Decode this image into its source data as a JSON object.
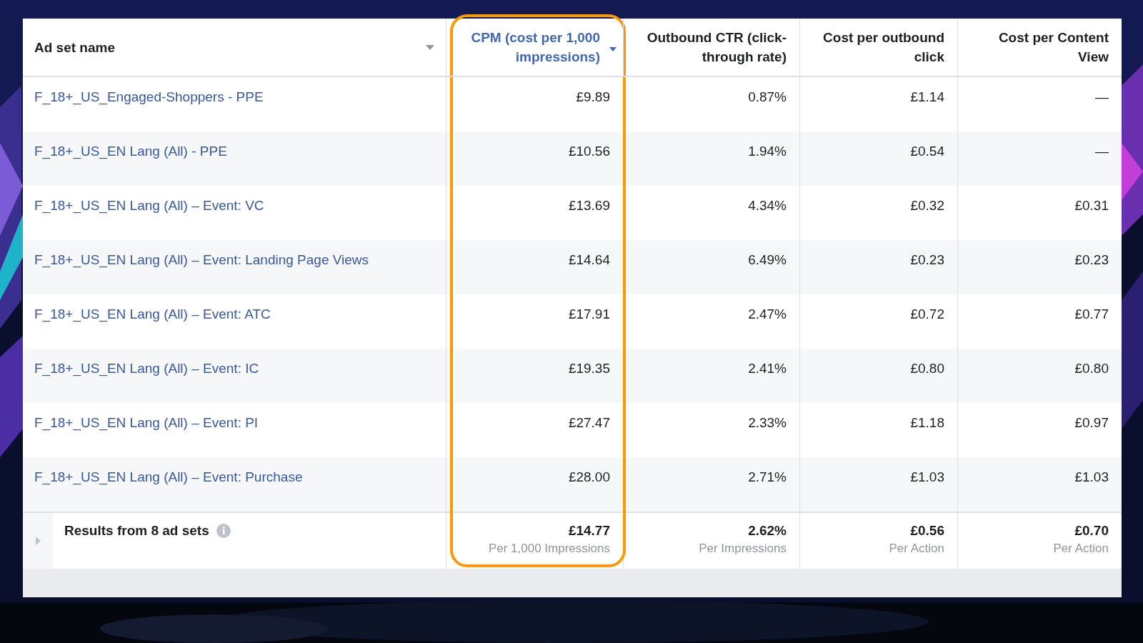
{
  "table": {
    "columns": [
      {
        "label": "Ad set name",
        "sorted": false,
        "dropdown": true,
        "highlighted": false
      },
      {
        "label": "CPM (cost per 1,000 impressions)",
        "sorted": true,
        "dropdown": false,
        "highlighted": true
      },
      {
        "label": "Outbound CTR (click-through rate)",
        "sorted": false,
        "dropdown": false,
        "highlighted": false
      },
      {
        "label": "Cost per outbound click",
        "sorted": false,
        "dropdown": false,
        "highlighted": false
      },
      {
        "label": "Cost per Content View",
        "sorted": false,
        "dropdown": false,
        "highlighted": false
      }
    ],
    "rows": [
      {
        "cells": [
          "F_18+_US_Engaged-Shoppers - PPE",
          "£9.89",
          "0.87%",
          "£1.14",
          "—"
        ]
      },
      {
        "cells": [
          "F_18+_US_EN Lang (All) - PPE",
          "£10.56",
          "1.94%",
          "£0.54",
          "—"
        ]
      },
      {
        "cells": [
          "F_18+_US_EN Lang (All) – Event: VC",
          "£13.69",
          "4.34%",
          "£0.32",
          "£0.31"
        ]
      },
      {
        "cells": [
          "F_18+_US_EN Lang (All) – Event: Landing Page Views",
          "£14.64",
          "6.49%",
          "£0.23",
          "£0.23"
        ]
      },
      {
        "cells": [
          "F_18+_US_EN Lang (All) – Event: ATC",
          "£17.91",
          "2.47%",
          "£0.72",
          "£0.77"
        ]
      },
      {
        "cells": [
          "F_18+_US_EN Lang (All) – Event: IC",
          "£19.35",
          "2.41%",
          "£0.80",
          "£0.80"
        ]
      },
      {
        "cells": [
          "F_18+_US_EN Lang (All) – Event: PI",
          "£27.47",
          "2.33%",
          "£1.18",
          "£0.97"
        ]
      },
      {
        "cells": [
          "F_18+_US_EN Lang (All) – Event: Purchase",
          "£28.00",
          "2.71%",
          "£1.03",
          "£1.03"
        ]
      }
    ],
    "summary": {
      "label": "Results from 8 ad sets",
      "expanded": false,
      "totals": [
        {
          "value": "£14.77",
          "note": "Per 1,000 Impressions"
        },
        {
          "value": "2.62%",
          "note": "Per Impressions"
        },
        {
          "value": "£0.56",
          "note": "Per Action"
        },
        {
          "value": "£0.70",
          "note": "Per Action"
        }
      ]
    }
  }
}
